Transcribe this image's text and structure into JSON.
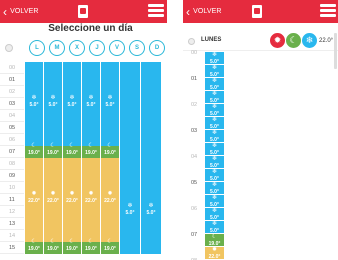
{
  "left_screen": {
    "back_label": "VOLVER",
    "title": "Seleccione un día",
    "days": [
      "L",
      "M",
      "X",
      "J",
      "V",
      "S",
      "D"
    ],
    "hours": [
      "00",
      "01",
      "02",
      "03",
      "04",
      "05",
      "06",
      "07",
      "08",
      "09",
      "10",
      "11",
      "12",
      "13",
      "14",
      "15"
    ],
    "temp_low": "5.0°",
    "temp_eco": "19.0°",
    "temp_comfort": "22.0°"
  },
  "right_screen": {
    "back_label": "VOLVER",
    "day_name": "LUNES",
    "current_temp": "22.0°",
    "hours": [
      "00",
      "01",
      "02",
      "03",
      "04",
      "05",
      "06",
      "07",
      "08"
    ],
    "cells": [
      {
        "mode": "low",
        "temp": "5.0°"
      },
      {
        "mode": "low",
        "temp": "5.0°"
      },
      {
        "mode": "low",
        "temp": "5.0°"
      },
      {
        "mode": "low",
        "temp": "5.0°"
      },
      {
        "mode": "low",
        "temp": "5.0°"
      },
      {
        "mode": "low",
        "temp": "5.0°"
      },
      {
        "mode": "low",
        "temp": "5.0°"
      },
      {
        "mode": "low",
        "temp": "5.0°"
      },
      {
        "mode": "low",
        "temp": "5.0°"
      },
      {
        "mode": "low",
        "temp": "5.0°"
      },
      {
        "mode": "low",
        "temp": "5.0°"
      },
      {
        "mode": "low",
        "temp": "5.0°"
      },
      {
        "mode": "low",
        "temp": "5.0°"
      },
      {
        "mode": "low",
        "temp": "5.0°"
      },
      {
        "mode": "eco",
        "temp": "19.0°"
      },
      {
        "mode": "comfort",
        "temp": "22.0°"
      }
    ]
  },
  "colors": {
    "topbar": "#e52b3e",
    "low": "#29b7ee",
    "eco": "#6ab04c",
    "comfort": "#f1c561",
    "day_circle": "#2cb8d8"
  },
  "icons": {
    "back": "chevron-left-icon",
    "logo": "app-logo-icon",
    "menu": "hamburger-menu-icon",
    "low": "snowflake-icon",
    "eco": "moon-icon",
    "comfort": "sun-icon"
  }
}
